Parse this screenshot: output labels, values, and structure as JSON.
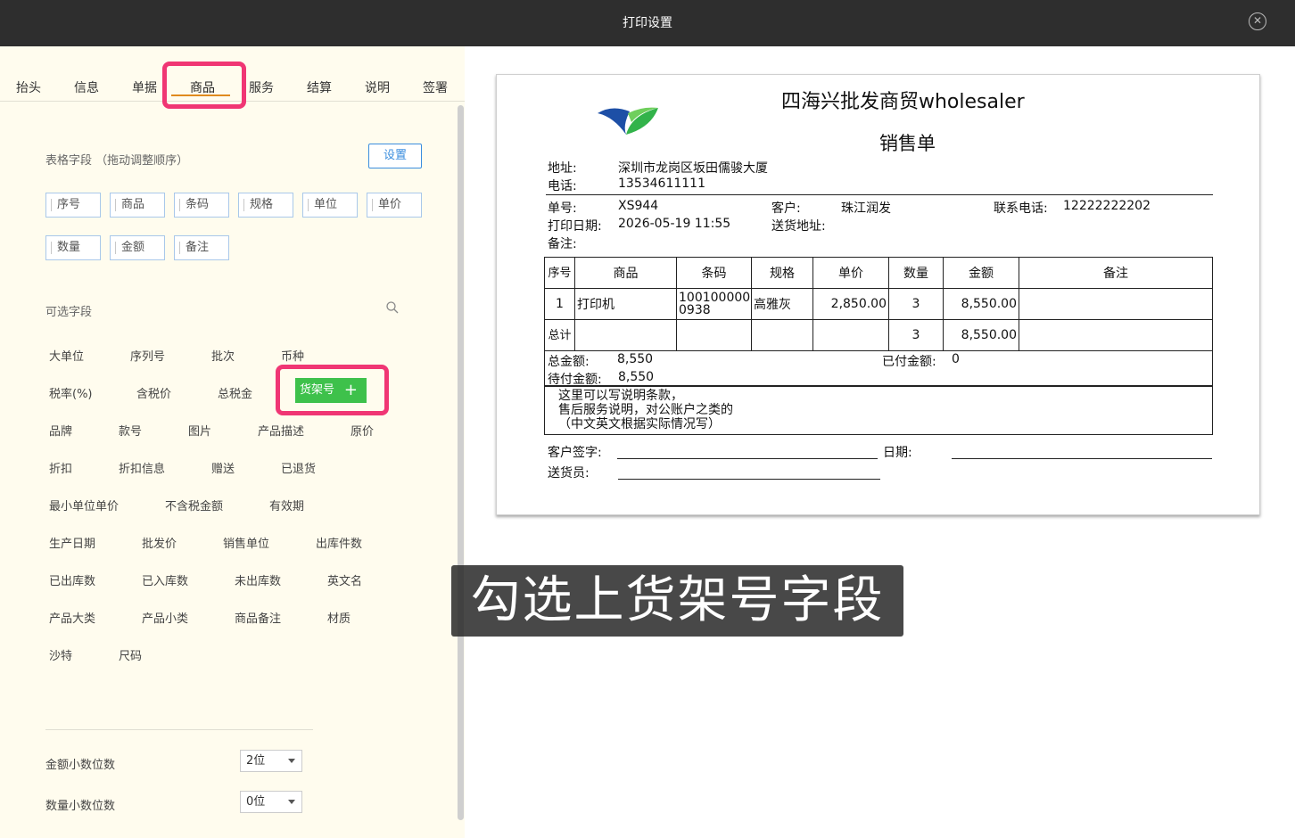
{
  "window": {
    "title": "打印设置",
    "close_icon": "close-circle-icon"
  },
  "tabs": [
    "抬头",
    "信息",
    "单据",
    "商品",
    "服务",
    "结算",
    "说明",
    "签署"
  ],
  "active_tab": "商品",
  "table_fields": {
    "label": "表格字段 （拖动调整顺序）",
    "set_button": "设置",
    "chips": [
      "序号",
      "商品",
      "条码",
      "规格",
      "单位",
      "单价",
      "数量",
      "金额",
      "备注"
    ]
  },
  "optional_fields": {
    "label": "可选字段",
    "search_icon": "search-icon",
    "items": [
      "大单位",
      "序列号",
      "批次",
      "币种",
      "税率(%)",
      "含税价",
      "总税金",
      "品牌",
      "款号",
      "图片",
      "产品描述",
      "原价",
      "折扣",
      "折扣信息",
      "赠送",
      "已退货",
      "最小单位单价",
      "不含税金额",
      "有效期",
      "生产日期",
      "批发价",
      "销售单位",
      "出库件数",
      "已出库数",
      "已入库数",
      "未出库数",
      "英文名",
      "产品大类",
      "产品小类",
      "商品备注",
      "材质",
      "沙特",
      "尺码"
    ],
    "selected_button": {
      "label": "货架号",
      "plus": "+"
    }
  },
  "settings": {
    "amount_decimals_label": "金额小数位数",
    "amount_decimals_value": "2位",
    "qty_decimals_label": "数量小数位数",
    "qty_decimals_value": "0位"
  },
  "preview": {
    "company": "四海兴批发商贸wholesaler",
    "doc_title": "销售单",
    "address_label": "地址:",
    "address": "深圳市龙岗区坂田儒骏大厦",
    "phone_label": "电话:",
    "phone": "13534611111",
    "order_no_label": "单号:",
    "order_no": "XS944",
    "customer_label": "客户:",
    "customer": "珠江润发",
    "contact_label": "联系电话:",
    "contact": "12222222202",
    "print_date_label": "打印日期:",
    "print_date": "2026-05-19 11:55",
    "delivery_addr_label": "送货地址:",
    "remark_label": "备注:",
    "headers": [
      "序号",
      "商品",
      "条码",
      "规格",
      "单价",
      "数量",
      "金额",
      "备注"
    ],
    "row": {
      "no": "1",
      "name": "打印机",
      "barcode_1": "100100000",
      "barcode_2": "0938",
      "spec": "高雅灰",
      "price": "2,850.00",
      "qty": "3",
      "amount": "8,550.00",
      "remark": ""
    },
    "total_label": "总计",
    "total_qty": "3",
    "total_amount": "8,550.00",
    "sum_label": "总金额:",
    "sum_value": "8,550",
    "paid_label": "已付金额:",
    "paid_value": "0",
    "due_label": "待付金额:",
    "due_value": "8,550",
    "note_1": "这里可以写说明条款，",
    "note_2": "售后服务说明，对公账户之类的",
    "note_3": "（中文英文根据实际情况写）",
    "sign_label": "客户签字:",
    "date_label": "日期:",
    "deliverer_label": "送货员:"
  },
  "caption": "勾选上货架号字段",
  "highlight_color": "#f03674",
  "accent_color": "#3ec14b"
}
